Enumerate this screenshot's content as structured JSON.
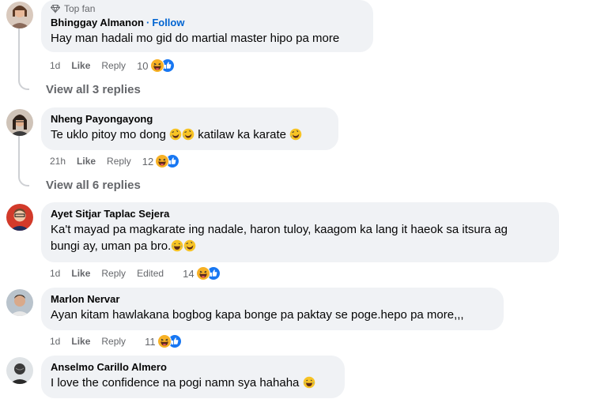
{
  "comments": [
    {
      "badge": "Top fan",
      "author": "Bhinggay Almanon",
      "follow": "Follow",
      "text": "Hay man hadali mo gid do martial master hipo pa more",
      "time": "1d",
      "like": "Like",
      "reply": "Reply",
      "reactions": "10",
      "view_replies": "View all 3 replies"
    },
    {
      "author": "Nheng Payongayong",
      "text_parts": [
        "Te uklo pitoy mo dong ",
        " katilaw ka karate "
      ],
      "time": "21h",
      "like": "Like",
      "reply": "Reply",
      "reactions": "12",
      "view_replies": "View all 6 replies"
    },
    {
      "author": "Ayet Sitjar Taplac Sejera",
      "text_line1": "Ka't mayad pa magkarate ing nadale, haron tuloy, kaagom ka lang it haeok sa itsura ag",
      "text_line2": "bungi ay, uman pa bro.",
      "time": "1d",
      "like": "Like",
      "reply": "Reply",
      "edited": "Edited",
      "reactions": "14"
    },
    {
      "author": "Marlon Nervar",
      "text": "Ayan kitam hawlakana bogbog kapa bonge pa paktay se poge.hepo pa more,,,",
      "time": "1d",
      "like": "Like",
      "reply": "Reply",
      "reactions": "11"
    },
    {
      "author": "Anselmo Carillo Almero",
      "text": "I love the confidence na pogi namn sya hahaha "
    }
  ],
  "colors": {
    "bubble": "#f0f2f5",
    "secondary_text": "#65676b",
    "link": "#0064d1",
    "haha": "#f7b125",
    "like": "#1877f2"
  },
  "icons": [
    "diamond-icon",
    "haha-emoji-icon",
    "like-reaction-icon",
    "rofl-emoji-icon",
    "laughing-emoji-icon"
  ]
}
